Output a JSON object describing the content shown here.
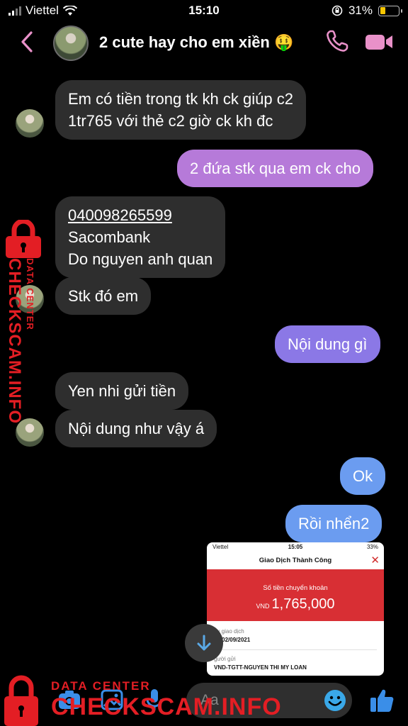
{
  "status_bar": {
    "carrier": "Viettel",
    "time": "15:10",
    "battery": "31%",
    "battery_level": 0.31
  },
  "header": {
    "title": "2 cute hay cho em xiền 🤑"
  },
  "messages": [
    {
      "side": "in",
      "lines": [
        "Em có tiền trong tk kh ck giúp c2",
        "1tr765 với thẻ c2 giờ ck kh đc"
      ]
    },
    {
      "side": "out",
      "text": "2 đứa stk qua em ck cho"
    },
    {
      "side": "in",
      "lines": [
        "040098265599",
        "Sacombank",
        "Do nguyen anh quan"
      ]
    },
    {
      "side": "in",
      "text": "Stk đó em"
    },
    {
      "side": "out",
      "text": "Nội dung gì"
    },
    {
      "side": "in",
      "text": "Yen nhi gửi tiền"
    },
    {
      "side": "in",
      "text": "Nội dung như vậy á"
    },
    {
      "side": "out",
      "text": "Ok"
    },
    {
      "side": "out",
      "text": "Rồi nhển2"
    }
  ],
  "receipt": {
    "carrier": "Viettel",
    "time": "15:05",
    "battery": "33%",
    "title": "Giao Dịch Thành Công",
    "amount_label": "Số tiền chuyển khoản",
    "currency": "VND",
    "amount": "1,765,000",
    "date_label": "ày giao dịch",
    "date_value": "05 02/09/2021",
    "sender_label": "gười gửi",
    "sender_value": "VND-TGTT-NGUYEN THI MY LOAN"
  },
  "composer": {
    "placeholder": "Aa"
  },
  "watermark": {
    "line1": "DATA CENTER",
    "line2": "CHECKSCAM.INFO"
  },
  "colors": {
    "incoming": "#2e2e2e",
    "out_pink": "#b67ad9",
    "out_lavender": "#8b78e6",
    "out_blue": "#6b9cf0",
    "accent": "#e991c9",
    "watermark": "#e31e24"
  }
}
